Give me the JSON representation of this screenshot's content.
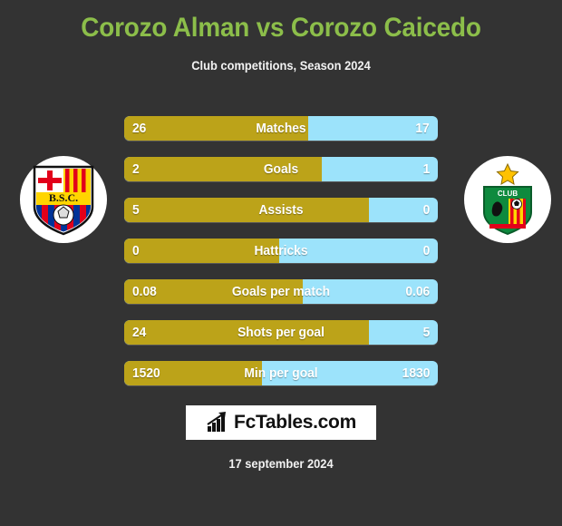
{
  "header": {
    "title": "Corozo Alman vs Corozo Caicedo",
    "subtitle": "Club competitions, Season 2024",
    "title_color": "#8CBE4A"
  },
  "colors": {
    "background": "#333333",
    "left_bar": "#BCA319",
    "right_bar": "#9CE3FB",
    "text": "#FFFFFF"
  },
  "badges": {
    "left": {
      "name": "barcelona-sc-crest",
      "initials": "B.S.C.",
      "colors": [
        "#E2001A",
        "#FFD500",
        "#003399"
      ]
    },
    "right": {
      "name": "club-deportivo-crest",
      "label": "CLUB",
      "colors": [
        "#0E8A3E",
        "#E2001A",
        "#FFD500"
      ]
    }
  },
  "stats": [
    {
      "label": "Matches",
      "left": "26",
      "right": "17",
      "left_pct": 58.7
    },
    {
      "label": "Goals",
      "left": "2",
      "right": "1",
      "left_pct": 63.0
    },
    {
      "label": "Assists",
      "left": "5",
      "right": "0",
      "left_pct": 78.0
    },
    {
      "label": "Hattricks",
      "left": "0",
      "right": "0",
      "left_pct": 49.5
    },
    {
      "label": "Goals per match",
      "left": "0.08",
      "right": "0.06",
      "left_pct": 57.0
    },
    {
      "label": "Shots per goal",
      "left": "24",
      "right": "5",
      "left_pct": 78.0
    },
    {
      "label": "Min per goal",
      "left": "1520",
      "right": "1830",
      "left_pct": 44.0
    }
  ],
  "footer": {
    "logo_text": "FcTables.com",
    "date": "17 september 2024"
  }
}
